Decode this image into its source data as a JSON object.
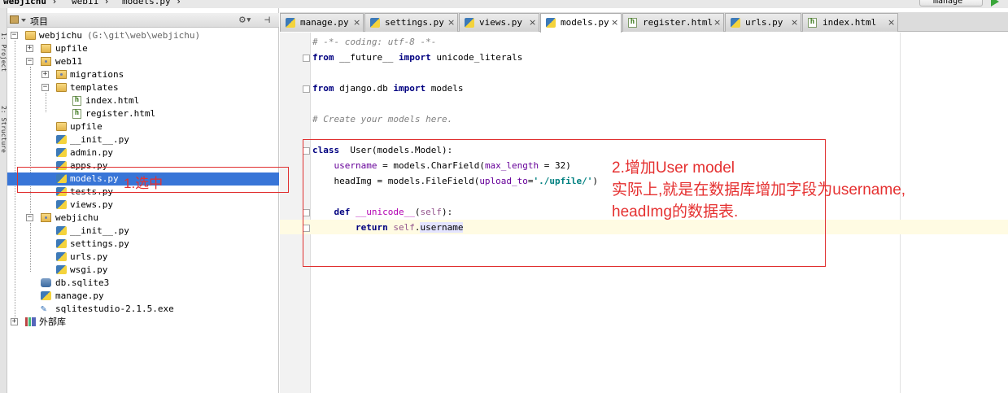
{
  "breadcrumb": [
    "webjichu",
    "web11",
    "models.py"
  ],
  "run_config": "manage",
  "side_tool_labels": [
    "1: Project",
    "2: Structure"
  ],
  "project_panel": {
    "title": "项目"
  },
  "tree": [
    {
      "label": "webjichu",
      "extra": "(G:\\git\\web\\webjichu)"
    },
    {
      "label": "upfile"
    },
    {
      "label": "web11"
    },
    {
      "label": "migrations"
    },
    {
      "label": "templates"
    },
    {
      "label": "index.html"
    },
    {
      "label": "register.html"
    },
    {
      "label": "upfile"
    },
    {
      "label": "__init__.py"
    },
    {
      "label": "admin.py"
    },
    {
      "label": "apps.py"
    },
    {
      "label": "models.py"
    },
    {
      "label": "tests.py"
    },
    {
      "label": "views.py"
    },
    {
      "label": "webjichu"
    },
    {
      "label": "__init__.py"
    },
    {
      "label": "settings.py"
    },
    {
      "label": "urls.py"
    },
    {
      "label": "wsgi.py"
    },
    {
      "label": "db.sqlite3"
    },
    {
      "label": "manage.py"
    },
    {
      "label": "sqlitestudio-2.1.5.exe"
    },
    {
      "label": "外部库"
    }
  ],
  "tabs": [
    {
      "label": "manage.py"
    },
    {
      "label": "settings.py"
    },
    {
      "label": "views.py"
    },
    {
      "label": "models.py",
      "active": true
    },
    {
      "label": "register.html"
    },
    {
      "label": "urls.py"
    },
    {
      "label": "index.html"
    }
  ],
  "code": {
    "coding": "# -*- coding: utf-8 -*-",
    "l2_from": "from",
    "l2_mod": " __future__ ",
    "l2_import": "import",
    "l2_rest": " unicode_literals",
    "l4_from": "from",
    "l4_mod": " django.db ",
    "l4_import": "import",
    "l4_rest": " models",
    "comment": "# Create your models here.",
    "cls_kw": "class",
    "cls_rest": "  User(models.Model):",
    "f1_name": "    username",
    "f1_mid": " = models.CharField(",
    "f1_prm": "max_length",
    "f1_end": " = 32)",
    "f2_name": "    headImg",
    "f2_mid": " = models.FileField(",
    "f2_prm": "upload_to",
    "f2_eq": "=",
    "f2_str": "'./upfile/'",
    "f2_end": ")",
    "def_kw": "    def",
    "def_name": " __unicode__",
    "def_open": "(",
    "def_self": "self",
    "def_close": "):",
    "ret_kw": "        return",
    "ret_self": " self",
    "ret_dot": ".",
    "ret_attr": "username"
  },
  "annotations": {
    "select_note": "1.选中",
    "model_line1": "2.增加User model",
    "model_line2": "实际上,就是在数据库增加字段为username,",
    "model_line3": "headImg的数据表."
  },
  "colors": {
    "annotation": "#e53030",
    "selection": "#3875d7"
  }
}
